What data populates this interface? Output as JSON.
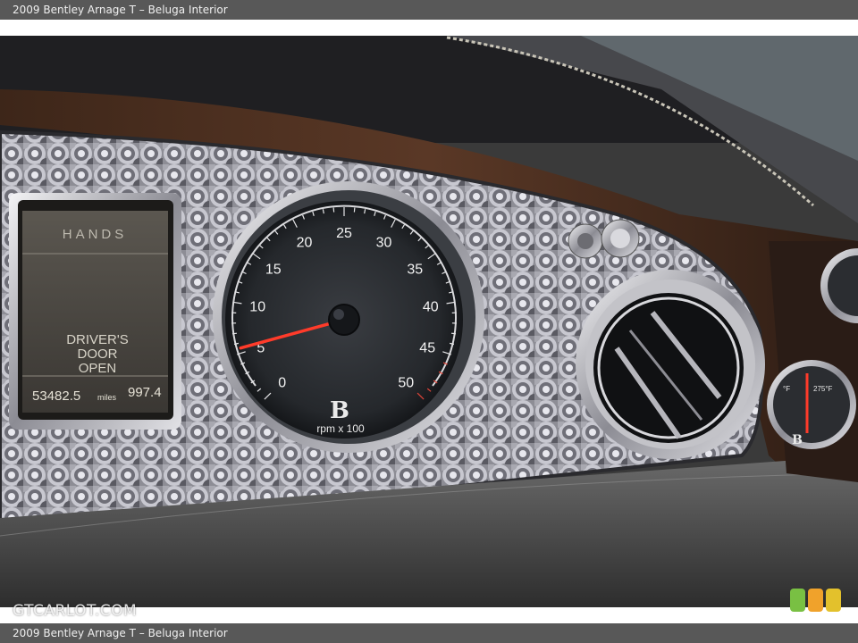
{
  "caption": {
    "title_top": "2009 Bentley Arnage T – Beluga Interior",
    "title_bottom": "2009 Bentley Arnage T – Beluga Interior"
  },
  "display": {
    "top_text": "HANDS",
    "message_line1": "DRIVER'S",
    "message_line2": "DOOR",
    "message_line3": "OPEN",
    "mileage": "53482.5",
    "mileage_unit": "miles",
    "trip": "997.4"
  },
  "tachometer": {
    "ticks": [
      "0",
      "5",
      "10",
      "15",
      "20",
      "25",
      "30",
      "35",
      "40",
      "45",
      "50"
    ],
    "unit": "rpm x 100",
    "logo": "B",
    "needle_value": 5.5,
    "max": 50
  },
  "temp_gauge": {
    "logo": "B",
    "left_label": "°F",
    "right_label": "275°F"
  },
  "watermark": "GTCARLOT.COM",
  "brand_colors": {
    "square1": "#79c043",
    "square2": "#f0a22b",
    "square3": "#e3c12c"
  }
}
